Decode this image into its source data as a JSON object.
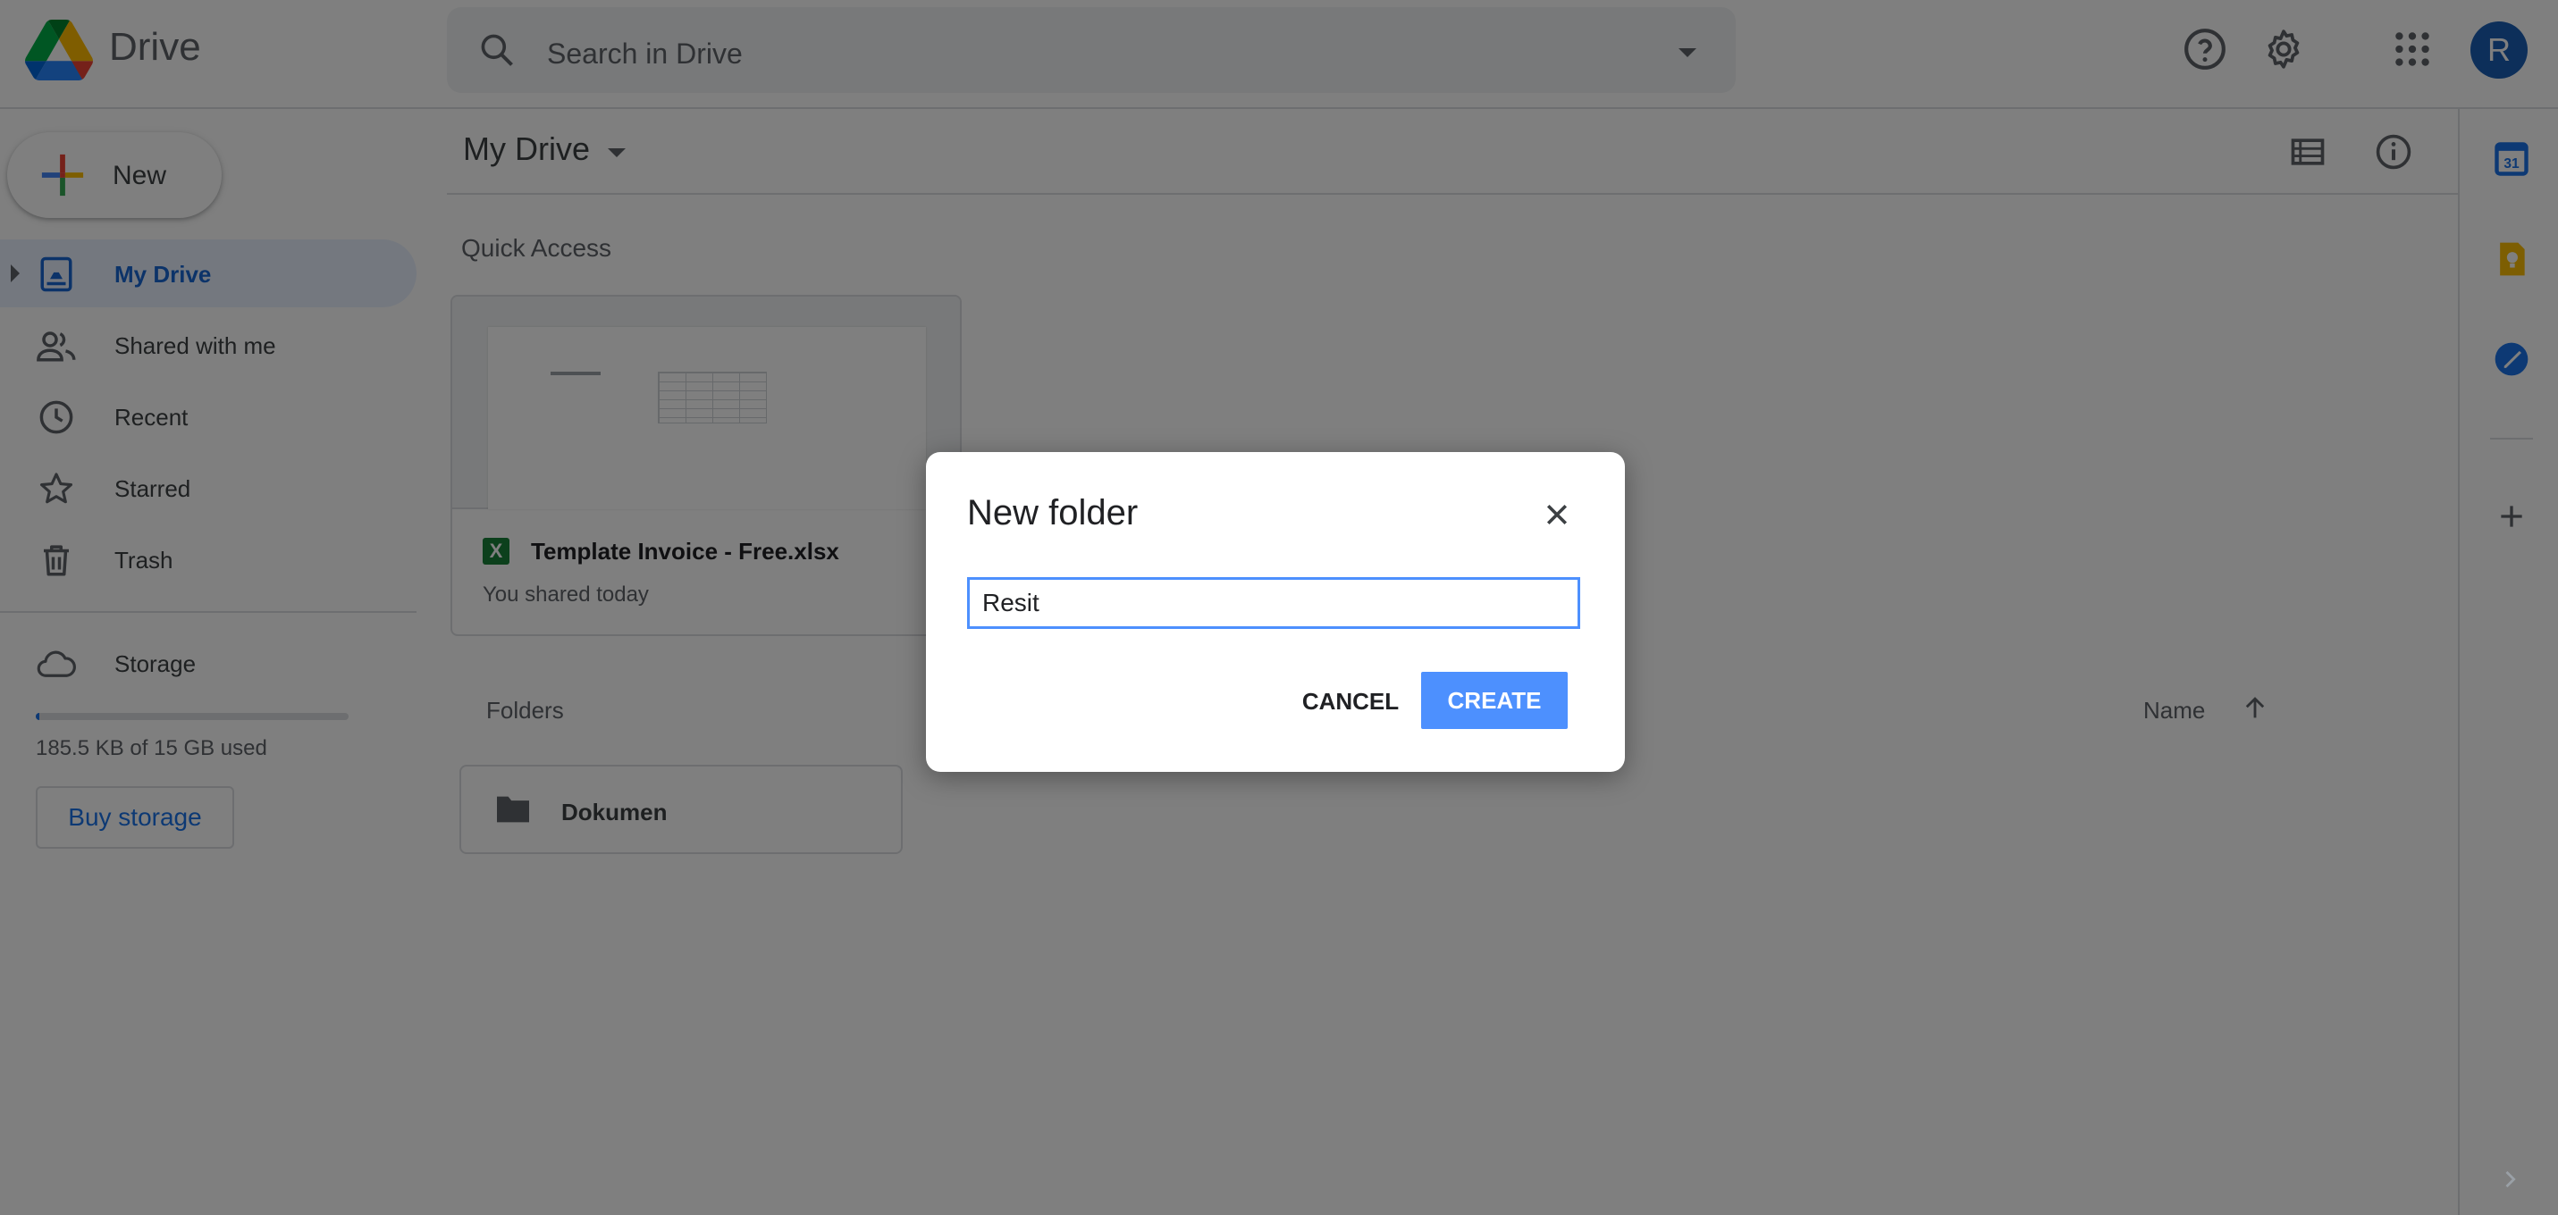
{
  "app": {
    "title": "Drive"
  },
  "search": {
    "placeholder": "Search in Drive"
  },
  "header": {
    "avatar_letter": "R",
    "help_icon": "help-icon",
    "settings_icon": "gear-icon",
    "apps_icon": "apps-grid-icon"
  },
  "sidebar": {
    "new_label": "New",
    "items": [
      {
        "label": "My Drive",
        "icon": "my-drive-icon",
        "active": true
      },
      {
        "label": "Shared with me",
        "icon": "shared-people-icon"
      },
      {
        "label": "Recent",
        "icon": "clock-icon"
      },
      {
        "label": "Starred",
        "icon": "star-icon"
      },
      {
        "label": "Trash",
        "icon": "trash-icon"
      }
    ],
    "storage": {
      "label": "Storage",
      "used_text": "185.5 KB of 15 GB used",
      "used_fraction": 0.01,
      "buy_label": "Buy storage"
    }
  },
  "main": {
    "title": "My Drive",
    "quick_access": {
      "heading": "Quick Access",
      "cards": [
        {
          "name": "Template Invoice - Free.xlsx",
          "subtitle": "You shared today",
          "file_badge": "X"
        }
      ]
    },
    "folders": {
      "heading": "Folders",
      "sort_label": "Name",
      "items": [
        {
          "name": "Dokumen"
        }
      ]
    }
  },
  "side_panel": {
    "apps": [
      "calendar-icon",
      "keep-icon",
      "tasks-icon"
    ],
    "add_icon": "plus-icon"
  },
  "dialog": {
    "title": "New folder",
    "input_value": "Resit",
    "cancel_label": "CANCEL",
    "create_label": "CREATE"
  },
  "colors": {
    "accent": "#1a73e8",
    "create_button": "#4d90fe",
    "active_nav_bg": "#e8f0fe",
    "overlay": "rgba(0,0,0,0.5)"
  }
}
